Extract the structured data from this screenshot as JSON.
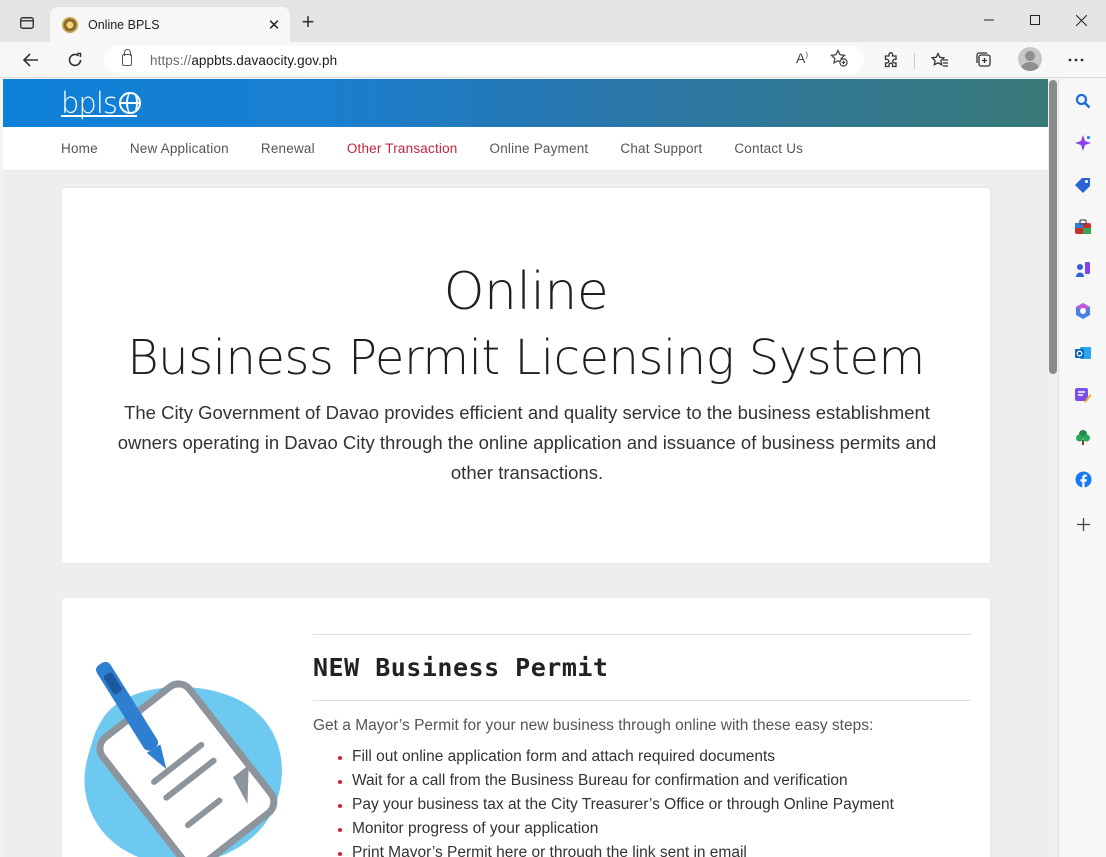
{
  "browser": {
    "tab_title": "Online BPLS",
    "url_protocol": "https://",
    "url_host": "appbts.davaocity.gov.ph",
    "read_aloud_label": "A",
    "icons": [
      "tab-actions-icon",
      "close-icon",
      "new-tab-icon",
      "minimize-icon",
      "maximize-icon",
      "window-close-icon",
      "back-icon",
      "refresh-icon",
      "lock-icon",
      "read-aloud-icon",
      "add-favorite-icon",
      "extensions-icon",
      "favorites-icon",
      "collections-icon",
      "profile-icon",
      "more-icon"
    ]
  },
  "edge_sidebar": {
    "icons": [
      "search-icon",
      "copilot-icon",
      "shopping-icon",
      "tools-icon",
      "games-icon",
      "microsoft365-icon",
      "outlook-icon",
      "designer-icon",
      "tree-icon",
      "facebook-icon",
      "add-icon"
    ]
  },
  "site": {
    "logo_text": "bpls",
    "nav": [
      {
        "label": "Home"
      },
      {
        "label": "New Application"
      },
      {
        "label": "Renewal"
      },
      {
        "label": "Other Transaction",
        "active": true
      },
      {
        "label": "Online Payment"
      },
      {
        "label": "Chat Support"
      },
      {
        "label": "Contact Us"
      }
    ],
    "colors": {
      "accent": "#c4253a",
      "header_gradient_start": "#0d80d8",
      "header_gradient_end": "#3a7a78"
    }
  },
  "hero": {
    "line1": "Online",
    "line2": "Business Permit Licensing System",
    "description": "The City Government of Davao provides efficient and quality service to the business establishment owners operating in Davao City through the online application and issuance of business permits and other transactions."
  },
  "new_permit": {
    "title": "NEW Business Permit",
    "intro": "Get a Mayor’s Permit for your new business through online with these easy steps:",
    "steps": [
      "Fill out online application form and attach required documents",
      "Wait for a call from the Business Bureau for confirmation and verification",
      "Pay your business tax at the City Treasurer’s Office or through Online Payment",
      "Monitor progress of your application",
      "Print Mayor’s Permit here or through the link sent in email"
    ]
  }
}
